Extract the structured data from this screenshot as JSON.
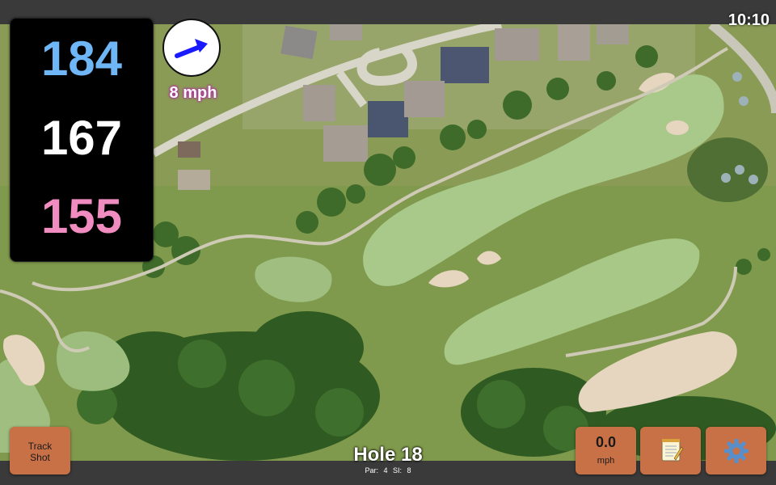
{
  "status_bar": {
    "time": "10:10"
  },
  "distances": {
    "back": "184",
    "middle": "167",
    "front": "155"
  },
  "wind": {
    "speed_label": "8 mph",
    "arrow_icon": "wind-direction-arrow-icon",
    "arrow_color": "#1a1aff",
    "label_color": "#b02ca0"
  },
  "hole": {
    "title": "Hole 18",
    "par": "Par: 4",
    "stroke_index": "SI: 8"
  },
  "buttons": {
    "track_shot_line1": "Track",
    "track_shot_line2": "Shot",
    "speed_value": "0.0",
    "speed_unit": "mph",
    "notes_icon": "notepad-icon",
    "settings_icon": "gear-icon"
  },
  "colors": {
    "button_bg": "#c97146",
    "back_yardage": "#6fb6f7",
    "middle_yardage": "#ffffff",
    "front_yardage": "#f08cc0"
  }
}
